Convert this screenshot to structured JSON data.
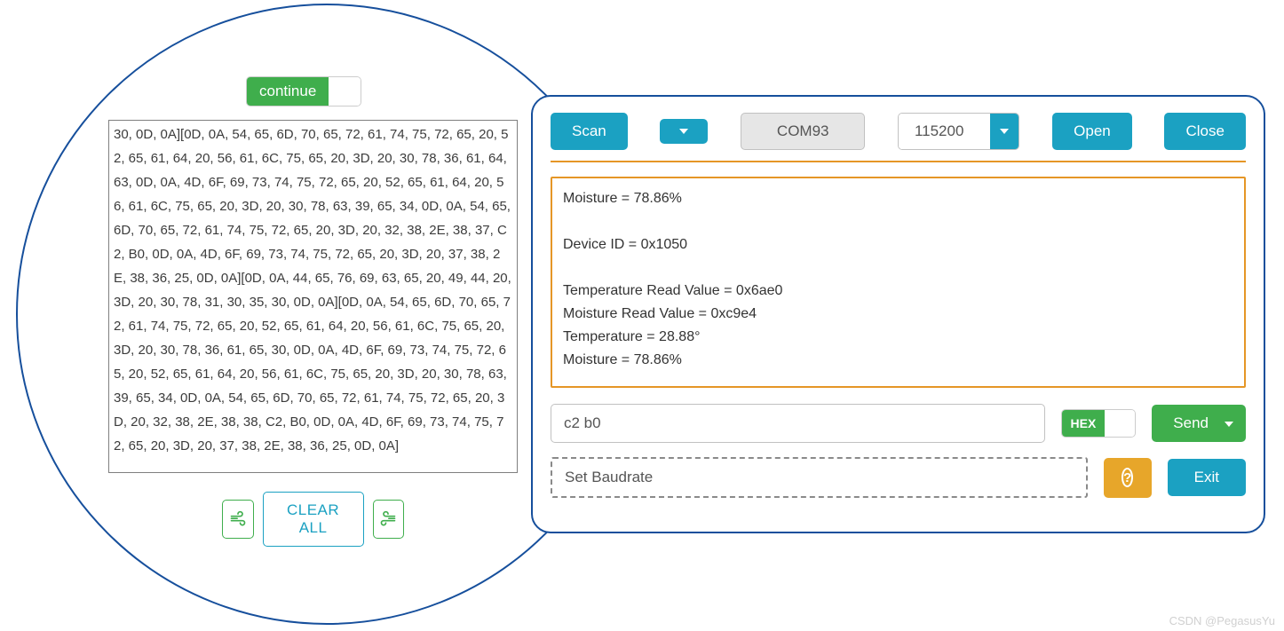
{
  "left": {
    "continue_label": "continue",
    "hex_dump": "30, 0D, 0A][0D, 0A, 54, 65, 6D, 70, 65, 72, 61, 74, 75, 72, 65, 20, 52, 65, 61, 64, 20, 56, 61, 6C, 75, 65, 20, 3D, 20, 30, 78, 36, 61, 64, 63, 0D, 0A, 4D, 6F, 69, 73, 74, 75, 72, 65, 20, 52, 65, 61, 64, 20, 56, 61, 6C, 75, 65, 20, 3D, 20, 30, 78, 63, 39, 65, 34, 0D, 0A, 54, 65, 6D, 70, 65, 72, 61, 74, 75, 72, 65, 20, 3D, 20, 32, 38, 2E, 38, 37, C2, B0, 0D, 0A, 4D, 6F, 69, 73, 74, 75, 72, 65, 20, 3D, 20, 37, 38, 2E, 38, 36, 25, 0D, 0A][0D, 0A, 44, 65, 76, 69, 63, 65, 20, 49, 44, 20, 3D, 20, 30, 78, 31, 30, 35, 30, 0D, 0A][0D, 0A, 54, 65, 6D, 70, 65, 72, 61, 74, 75, 72, 65, 20, 52, 65, 61, 64, 20, 56, 61, 6C, 75, 65, 20, 3D, 20, 30, 78, 36, 61, 65, 30, 0D, 0A, 4D, 6F, 69, 73, 74, 75, 72, 65, 20, 52, 65, 61, 64, 20, 56, 61, 6C, 75, 65, 20, 3D, 20, 30, 78, 63, 39, 65, 34, 0D, 0A, 54, 65, 6D, 70, 65, 72, 61, 74, 75, 72, 65, 20, 3D, 20, 32, 38, 2E, 38, 38, C2, B0, 0D, 0A, 4D, 6F, 69, 73, 74, 75, 72, 65, 20, 3D, 20, 37, 38, 2E, 38, 36, 25, 0D, 0A]",
    "clear_label": "CLEAR ALL"
  },
  "toolbar": {
    "scan_label": "Scan",
    "com_port": "COM93",
    "baud_rate": "115200",
    "open_label": "Open",
    "close_label": "Close"
  },
  "rx": {
    "content": "Moisture = 78.86%\n\nDevice ID = 0x1050\n\nTemperature Read Value = 0x6ae0\nMoisture Read Value = 0xc9e4\nTemperature = 28.88°\nMoisture = 78.86%"
  },
  "tx": {
    "value": "c2 b0",
    "hex_label": "HEX",
    "send_label": "Send"
  },
  "extra": {
    "set_baudrate_label": "Set Baudrate",
    "exit_label": "Exit",
    "help_glyph": "?"
  },
  "watermark": "CSDN @PegasusYu"
}
